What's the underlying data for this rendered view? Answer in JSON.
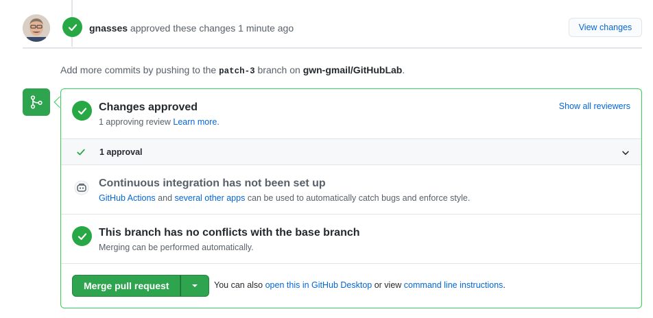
{
  "review": {
    "author": "gnasses",
    "action": " approved these changes ",
    "time": "1 minute ago",
    "view_changes_label": "View changes"
  },
  "push_hint": {
    "prefix": "Add more commits by pushing to the ",
    "branch": "patch-3",
    "middle": " branch on ",
    "repo": "gwn-gmail/GitHubLab",
    "suffix": "."
  },
  "merge_box": {
    "approved": {
      "title": "Changes approved",
      "subtext": "1 approving review ",
      "learn_more": "Learn more.",
      "show_reviewers": "Show all reviewers"
    },
    "approvals": {
      "label": "1 approval"
    },
    "ci": {
      "title": "Continuous integration has not been set up",
      "link1": "GitHub Actions",
      "and": " and ",
      "link2": "several other apps",
      "rest": " can be used to automatically catch bugs and enforce style."
    },
    "conflicts": {
      "title": "This branch has no conflicts with the base branch",
      "subtext": "Merging can be performed automatically."
    },
    "merge": {
      "button_label": "Merge pull request",
      "alt_prefix": "You can also ",
      "alt_link1": "open this in GitHub Desktop",
      "alt_middle": " or view ",
      "alt_link2": "command line instructions",
      "alt_suffix": "."
    }
  },
  "colors": {
    "success": "#28a745",
    "link": "#0366d6",
    "border_success": "#34d058"
  },
  "icons": {
    "review_badge": "check-icon",
    "merge_box_icon": "git-merge-icon",
    "ci_icon": "robot-icon",
    "chevron": "chevron-down-icon"
  }
}
